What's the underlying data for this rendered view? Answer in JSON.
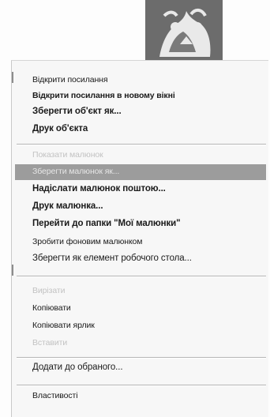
{
  "thumbnail": {
    "icon": "folk-ornament-image"
  },
  "menu": {
    "items": [
      {
        "label": "Відкрити посилання",
        "state": "normal"
      },
      {
        "label": "Відкрити посилання в новому вікні",
        "state": "normal"
      },
      {
        "label": "Зберегти об'єкт як...",
        "state": "normal"
      },
      {
        "label": "Друк об'єкта",
        "state": "normal"
      },
      {
        "label": "Показати малюнок",
        "state": "disabled"
      },
      {
        "label": "Зберегти малюнок як...",
        "state": "highlighted"
      },
      {
        "label": "Надіслати малюнок поштою...",
        "state": "normal"
      },
      {
        "label": "Друк малюнка...",
        "state": "normal"
      },
      {
        "label": "Перейти до папки \"Мої малюнки\"",
        "state": "normal"
      },
      {
        "label": "Зробити фоновим малюнком",
        "state": "normal"
      },
      {
        "label": "Зберегти як елемент робочого стола...",
        "state": "normal"
      },
      {
        "label": "Вирізати",
        "state": "disabled"
      },
      {
        "label": "Копіювати",
        "state": "normal"
      },
      {
        "label": "Копіювати ярлик",
        "state": "normal"
      },
      {
        "label": "Вставити",
        "state": "disabled"
      },
      {
        "label": "Додати до обраного...",
        "state": "normal"
      },
      {
        "label": "Властивості",
        "state": "normal"
      }
    ]
  },
  "colors": {
    "highlight": "#9c9c9c",
    "disabled_text": "#c2c2c2",
    "text": "#1a1a1a"
  }
}
